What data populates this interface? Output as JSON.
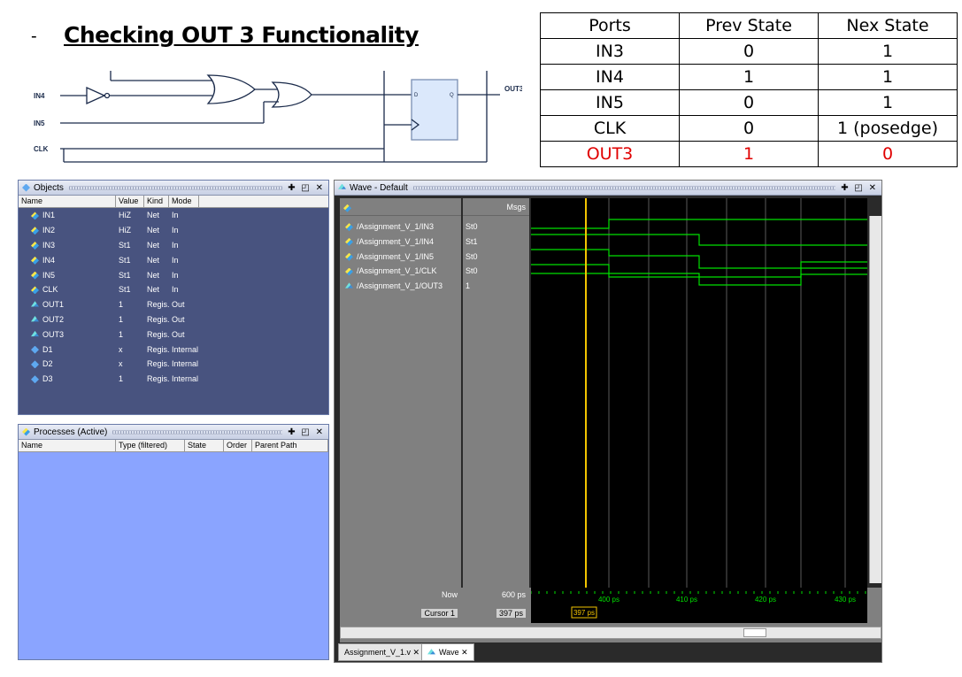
{
  "heading": {
    "dash": "-",
    "title": "Checking OUT 3 Functionality"
  },
  "circuit": {
    "labels": {
      "in4": "IN4",
      "in5": "IN5",
      "clk": "CLK",
      "out3": "OUT3",
      "d": "D",
      "q": "Q"
    }
  },
  "state_table": {
    "headers": [
      "Ports",
      "Prev State",
      "Nex State"
    ],
    "rows": [
      [
        "IN3",
        "0",
        "1"
      ],
      [
        "IN4",
        "1",
        "1"
      ],
      [
        "IN5",
        "0",
        "1"
      ],
      [
        "CLK",
        "0",
        "1 (posedge)"
      ],
      [
        "OUT3",
        "1",
        "0"
      ]
    ],
    "highlight_color": "#e00000"
  },
  "objects": {
    "title": "Objects",
    "columns": [
      "Name",
      "Value",
      "Kind",
      "Mode"
    ],
    "items": [
      {
        "name": "IN1",
        "value": "HiZ",
        "kind": "Net",
        "mode": "In",
        "icon": "input-icon"
      },
      {
        "name": "IN2",
        "value": "HiZ",
        "kind": "Net",
        "mode": "In",
        "icon": "input-icon"
      },
      {
        "name": "IN3",
        "value": "St1",
        "kind": "Net",
        "mode": "In",
        "icon": "input-icon"
      },
      {
        "name": "IN4",
        "value": "St1",
        "kind": "Net",
        "mode": "In",
        "icon": "input-icon"
      },
      {
        "name": "IN5",
        "value": "St1",
        "kind": "Net",
        "mode": "In",
        "icon": "input-icon"
      },
      {
        "name": "CLK",
        "value": "St1",
        "kind": "Net",
        "mode": "In",
        "icon": "input-icon"
      },
      {
        "name": "OUT1",
        "value": "1",
        "kind": "Regis...",
        "mode": "Out",
        "icon": "output-icon"
      },
      {
        "name": "OUT2",
        "value": "1",
        "kind": "Regis...",
        "mode": "Out",
        "icon": "output-icon"
      },
      {
        "name": "OUT3",
        "value": "1",
        "kind": "Regis...",
        "mode": "Out",
        "icon": "output-icon"
      },
      {
        "name": "D1",
        "value": "x",
        "kind": "Regis...",
        "mode": "Internal",
        "icon": "internal-icon"
      },
      {
        "name": "D2",
        "value": "x",
        "kind": "Regis...",
        "mode": "Internal",
        "icon": "internal-icon"
      },
      {
        "name": "D3",
        "value": "1",
        "kind": "Regis...",
        "mode": "Internal",
        "icon": "internal-icon"
      }
    ]
  },
  "processes": {
    "title": "Processes (Active)",
    "columns": [
      "Name",
      "Type (filtered)",
      "State",
      "Order",
      "Parent Path"
    ]
  },
  "wave": {
    "title": "Wave - Default",
    "msgs_header": "Msgs",
    "signals": [
      {
        "name": "/Assignment_V_1/IN3",
        "msg": "St0"
      },
      {
        "name": "/Assignment_V_1/IN4",
        "msg": "St1"
      },
      {
        "name": "/Assignment_V_1/IN5",
        "msg": "St0"
      },
      {
        "name": "/Assignment_V_1/CLK",
        "msg": "St0"
      },
      {
        "name": "/Assignment_V_1/OUT3",
        "msg": "1"
      }
    ],
    "now_label": "Now",
    "now_value": "600 ps",
    "cursor_label": "Cursor 1",
    "cursor_value": "397 ps",
    "cursor_tag": "397 ps",
    "time_ticks": [
      "400 ps",
      "410 ps",
      "420 ps",
      "430 ps"
    ],
    "wave_color": "#00e000",
    "cursor_color": "#f2c400",
    "tabs": [
      "Assignment_V_1.v",
      "Wave"
    ]
  }
}
